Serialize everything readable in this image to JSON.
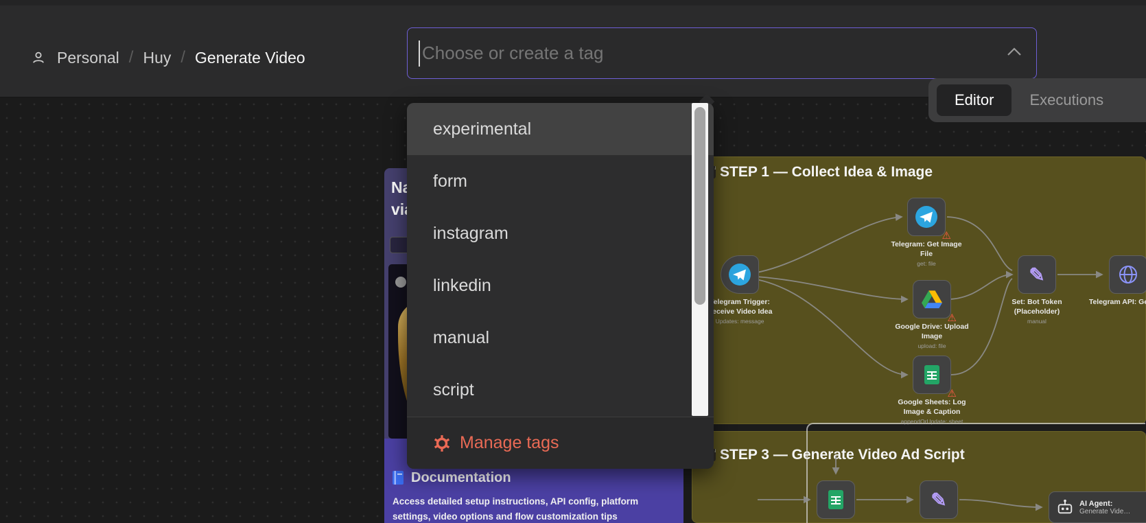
{
  "topbar": {
    "breadcrumb": {
      "items": [
        "Personal",
        "Huy",
        "Generate Video"
      ],
      "separator": "/"
    },
    "tag_input": {
      "placeholder": "Choose or create a tag"
    },
    "tabs": [
      {
        "label": "Editor",
        "active": true
      },
      {
        "label": "Executions",
        "active": false
      }
    ]
  },
  "tag_dropdown": {
    "items": [
      {
        "label": "experimental",
        "highlighted": true
      },
      {
        "label": "form",
        "highlighted": false
      },
      {
        "label": "instagram",
        "highlighted": false
      },
      {
        "label": "linkedin",
        "highlighted": false
      },
      {
        "label": "manual",
        "highlighted": false
      },
      {
        "label": "script",
        "highlighted": false
      }
    ],
    "manage": {
      "label": "Manage tags",
      "color": "#ea6a55"
    }
  },
  "canvas": {
    "purple_note": {
      "title_line1": "Na",
      "title_line2": "via",
      "doc": {
        "title": "Documentation",
        "line1": "Access detailed setup instructions, API config, platform",
        "line2": "settings, video options and flow customization tips"
      }
    },
    "step1": {
      "title": "STEP 1 — Collect Idea & Image",
      "nodes": [
        {
          "name": "Telegram Trigger: Receive Video Idea",
          "sub": "Updates: message"
        },
        {
          "name": "Telegram: Get Image File",
          "sub": "get: file"
        },
        {
          "name": "Google Drive: Upload Image",
          "sub": "upload: file"
        },
        {
          "name": "Google Sheets: Log Image & Caption",
          "sub": "appendOrUpdate: sheet"
        },
        {
          "name": "Set: Bot Token (Placeholder)",
          "sub": "manual"
        },
        {
          "name": "Telegram API: Get URL",
          "sub": ""
        }
      ]
    },
    "step3": {
      "title": "STEP 3 — Generate Video Ad Script",
      "agent": {
        "name": "AI Agent:",
        "sub": "Generate Vide…"
      }
    }
  },
  "colors": {
    "accent_purple_border": "#6e5fd6",
    "manage_orange": "#ea6a55",
    "note_olive": "#57501e",
    "note_purple": "#45406e",
    "doc_purple": "#4b40a3",
    "telegram_blue": "#2ca5e0",
    "sheets_green": "#23a566",
    "warning_red": "#ff5b49"
  }
}
